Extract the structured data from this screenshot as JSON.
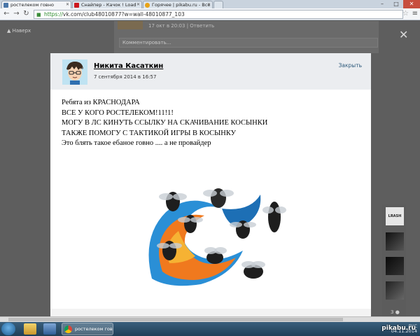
{
  "browser": {
    "tabs": [
      {
        "label": "ростелеком говно",
        "color": "#4a76a8",
        "active": true
      },
      {
        "label": "Снайпер - Качок ! Load",
        "color": "#cc181e",
        "active": false
      },
      {
        "label": "Горячее | pikabu.ru - Все",
        "color": "#e8a317",
        "active": false
      }
    ],
    "url_scheme": "https://",
    "url_rest": "vk.com/club48010877?w=wall-48010877_103",
    "window_buttons": {
      "minimize": "–",
      "maximize": "□",
      "close": "✕"
    }
  },
  "background_page": {
    "sidebar_up_label": "Наверх",
    "post_meta": "17 окт в 20:03",
    "reply_link": "Ответить",
    "comment_placeholder": "Комментировать..."
  },
  "post": {
    "author": "Никита Касаткин",
    "date": "7 сентября 2014 в 16:57",
    "close_label": "Закрыть",
    "lines": [
      "Ребята из КРАСНОДАРА",
      "ВСЕ У КОГО РОСТЕЛЕКОМ!11!1!",
      "МОГУ В ЛС КИНУТЬ ССЫЛКУ НА СКАЧИВАНИЕ КОСЫНКИ",
      "ТАКЖЕ ПОМОГУ С ТАКТИКОЙ ИГРЫ В КОСЫНКУ",
      "Это блять такое ебаное говно .... а не провайдер"
    ]
  },
  "right_strip": {
    "first_label": "LRASH",
    "likes_count": "3"
  },
  "taskbar": {
    "active_app": "ростелеком говно...",
    "tray_lang": "РУС",
    "tray_date": "04.11.2014"
  },
  "watermark": "pikabu.ru",
  "colors": {
    "link": "#2b587a",
    "overlay": "#5e5e5e",
    "header_bg": "#ebedf0"
  }
}
